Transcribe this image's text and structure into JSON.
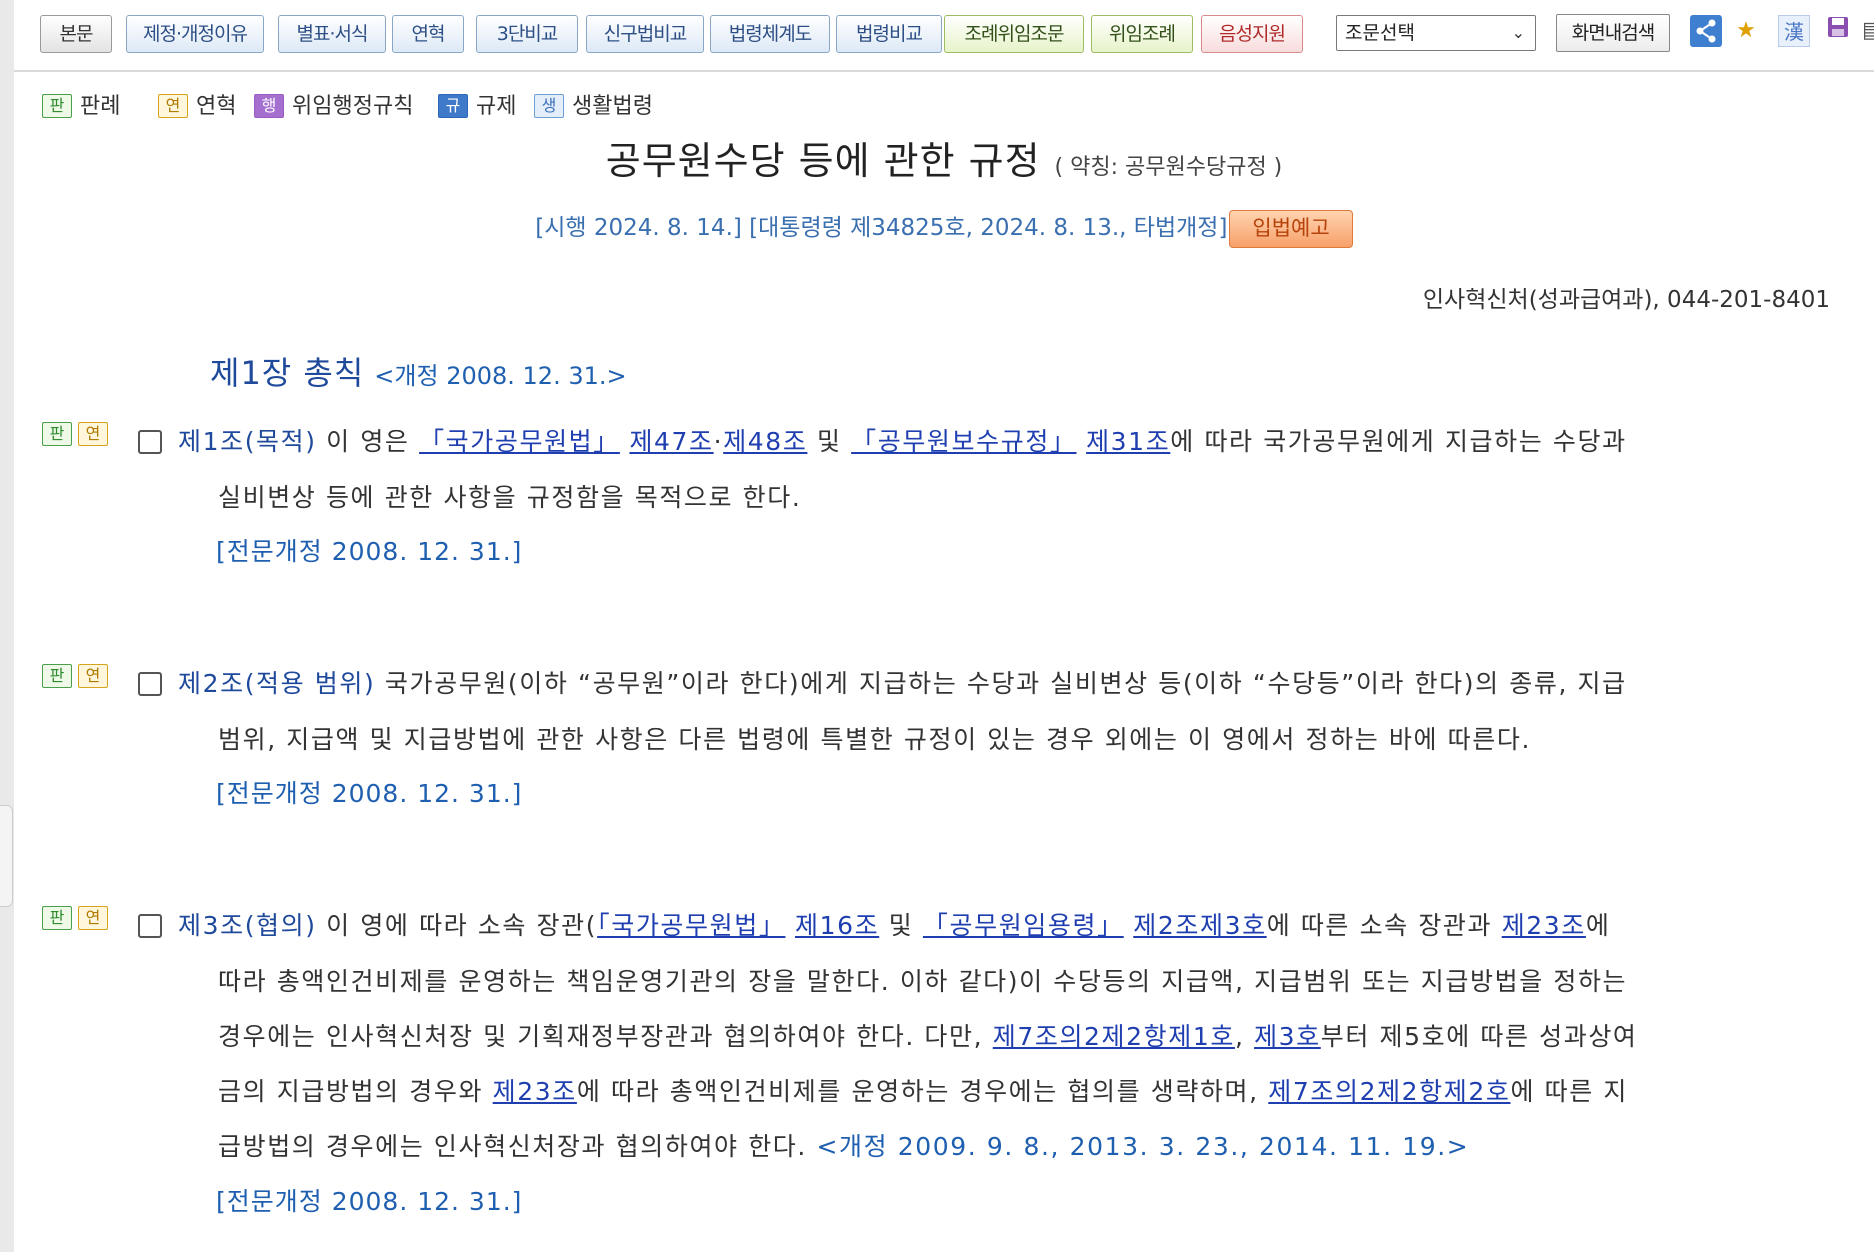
{
  "toolbar": {
    "buttons": [
      "본문",
      "제정·개정이유",
      "별표·서식",
      "연혁",
      "3단비교",
      "신구법비교",
      "법령체계도",
      "법령비교",
      "조례위임조문",
      "위임조례",
      "음성지원"
    ],
    "select_value": "조문선택",
    "search_label": "화면내검색",
    "icons": [
      "share-icon",
      "star-icon",
      "hanja-icon",
      "save-icon",
      "print-icon"
    ],
    "hanja_glyph": "漢"
  },
  "legend": {
    "items": [
      {
        "badge": "판",
        "label": "판례"
      },
      {
        "badge": "연",
        "label": "연혁"
      },
      {
        "badge": "행",
        "label": "위임행정규칙"
      },
      {
        "badge": "규",
        "label": "규제"
      },
      {
        "badge": "생",
        "label": "생활법령"
      }
    ]
  },
  "law": {
    "title": "공무원수당 등에 관한 규정",
    "abbreviation": "( 약칭: 공무원수당규정 )",
    "enforcement": "[시행 2024. 8. 14.] [대통령령 제34825호, 2024. 8. 13., 타법개정]",
    "notice_button": "입법예고",
    "ministry": "인사혁신처(성과급여과), 044-201-8401"
  },
  "chapter": {
    "title": "제1장 총칙",
    "amend": "<개정 2008. 12. 31.>"
  },
  "articles": [
    {
      "badges": [
        "판",
        "연"
      ],
      "title": "제1조(목적)",
      "jeonmun": "[전문개정 2008. 12. 31.]",
      "t": [
        "이 영은 ",
        "「국가공무원법」",
        "제47조",
        "·",
        "제48조",
        "및",
        "「공무원보수규정」",
        "제31조",
        "에 따라 국가공무원에게 지급하는 수당과",
        "실비변상 등에 관한 사항을 규정함을 목적으로 한다."
      ]
    },
    {
      "badges": [
        "판",
        "연"
      ],
      "title": "제2조(적용 범위)",
      "jeonmun": "[전문개정 2008. 12. 31.]",
      "t": [
        "국가공무원(이하 “공무원”이라 한다)에게 지급하는 수당과 실비변상 등(이하 “수당등”이라 한다)의 종류, 지급",
        "범위, 지급액 및 지급방법에 관한 사항은 다른 법령에 특별한 규정이 있는 경우 외에는 이 영에서 정하는 바에 따른다."
      ]
    },
    {
      "badges": [
        "판",
        "연"
      ],
      "title": "제3조(협의)",
      "jeonmun": "[전문개정 2008. 12. 31.]",
      "amend": "<개정 2009. 9. 8., 2013. 3. 23., 2014. 11. 19.>",
      "t": [
        "이 영에 따라 소속 장관(",
        "「국가공무원법」",
        "제16조",
        "및",
        "「공무원임용령」",
        "제2조제3호",
        "에 따른 소속 장관과",
        "제23조",
        "에",
        "따라 총액인건비제를 운영하는 책임운영기관의 장을 말한다. 이하 같다)이 수당등의 지급액, 지급범위 또는 지급방법을 정하는",
        "경우에는 인사혁신처장 및 기획재정부장관과 협의하여야 한다. 다만,",
        "제7조의2제2항제1호",
        ",",
        "제3호",
        "부터 제5호에 따른 성과상여",
        "금의 지급방법의 경우와",
        "제23조",
        "에 따라 총액인건비제를 운영하는 경우에는 협의를 생략하며,",
        "제7조의2제2항제2호",
        "에 따른 지",
        "급방법의 경우에는 인사혁신처장과 협의하여야 한다."
      ]
    }
  ],
  "colors": {
    "link": "#1f3fb0",
    "title_blue": "#1f4a9c",
    "amend_blue": "#1f5fb0",
    "notice_orange": "#f7a06a"
  }
}
